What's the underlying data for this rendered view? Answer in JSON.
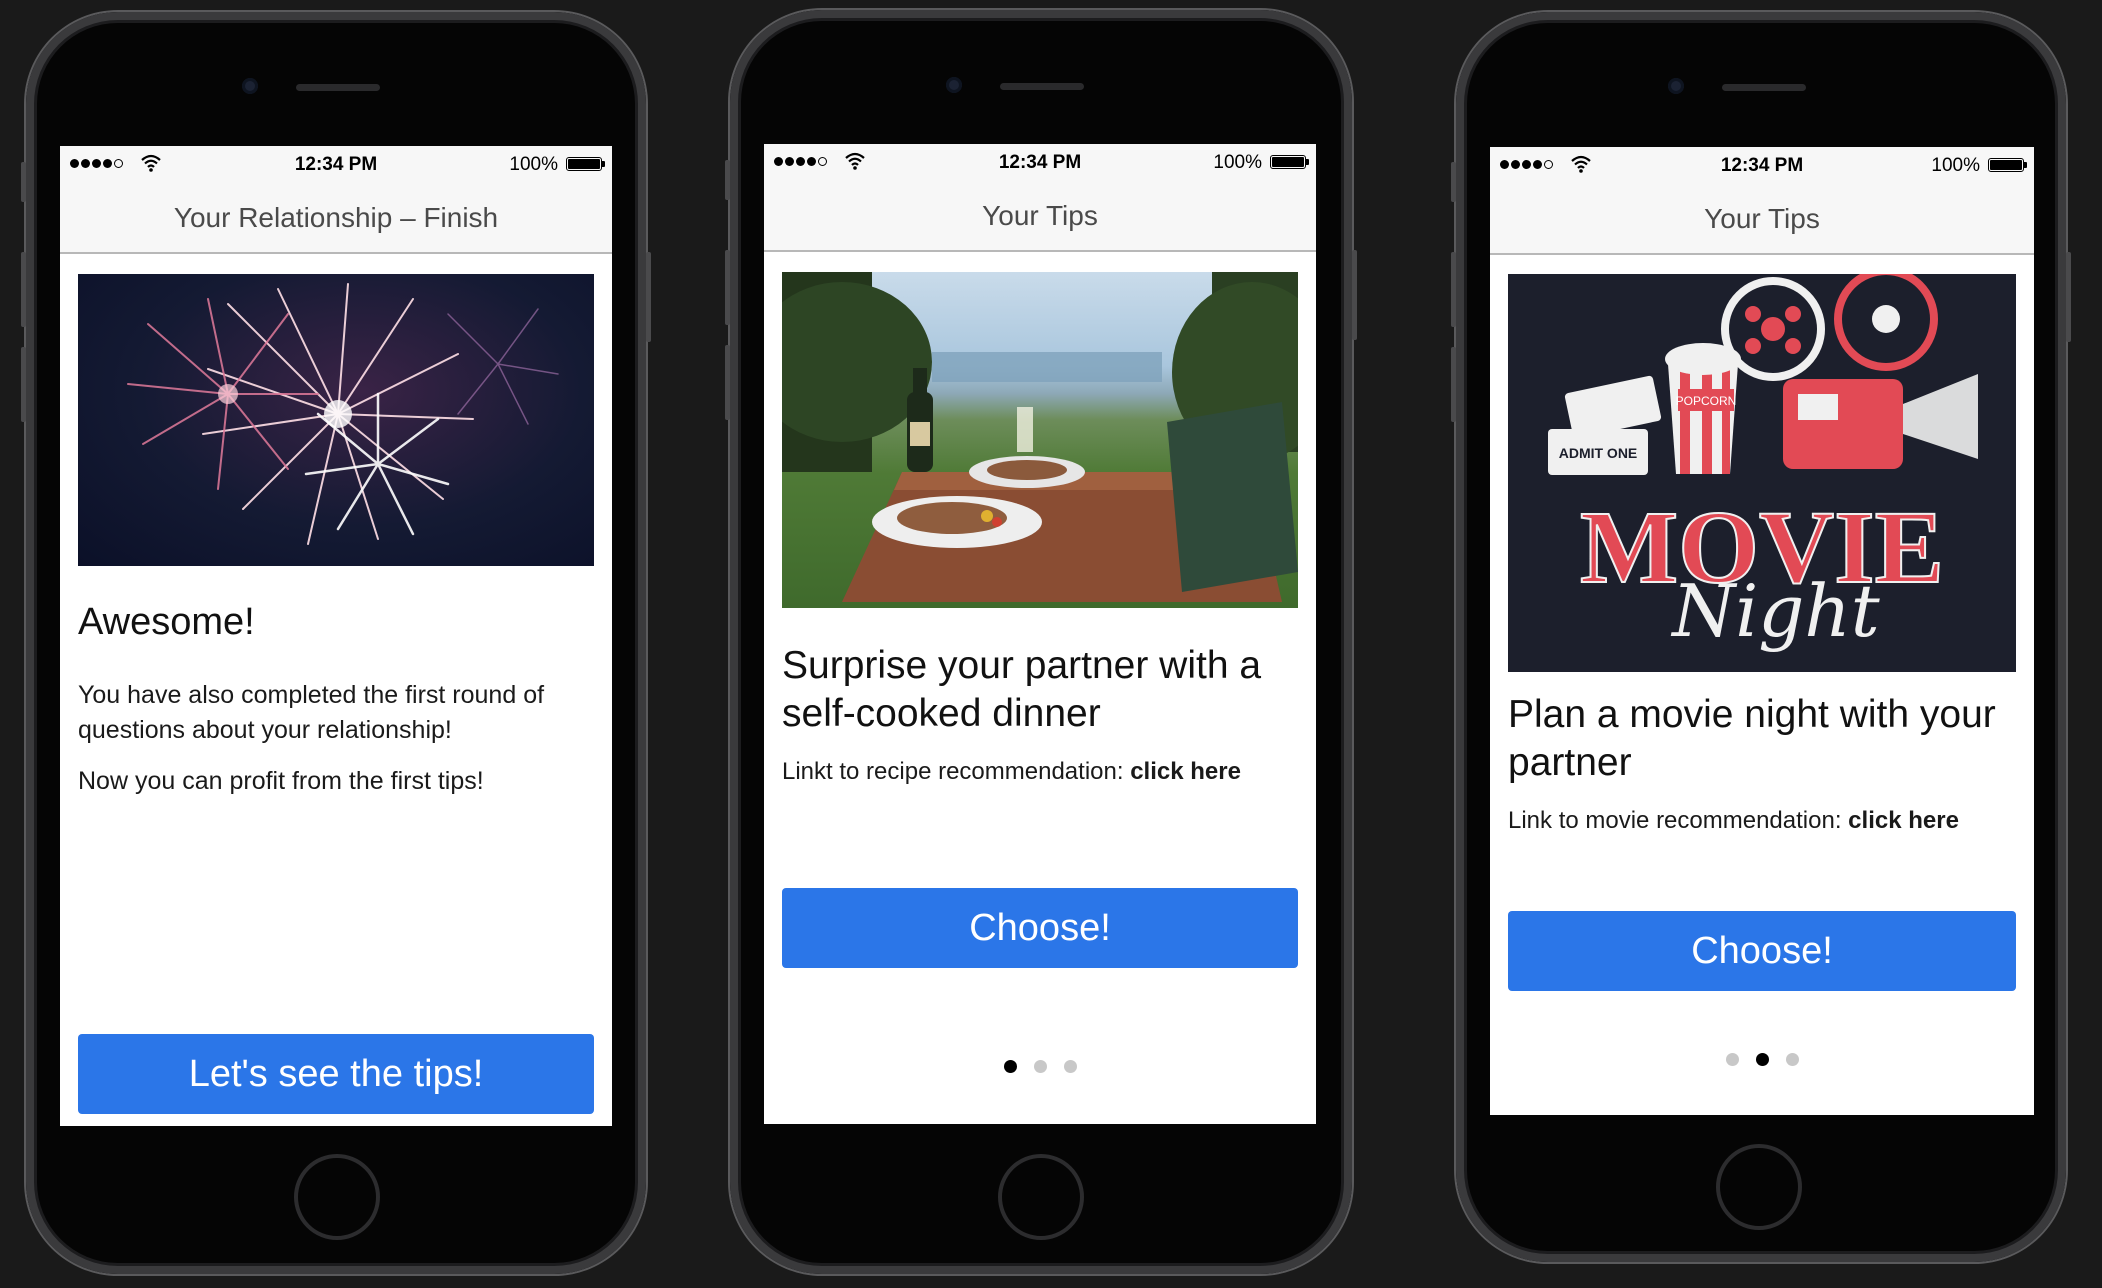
{
  "phones": [
    {
      "status": {
        "time": "12:34 PM",
        "battery": "100%"
      },
      "nav_title": "Your Relationship – Finish",
      "image": "fireworks-image",
      "heading": "Awesome!",
      "paragraph1": "You have also completed the first round of questions about your relationship!",
      "paragraph2": "Now you can profit from the first tips!",
      "button": "Let's see the tips!"
    },
    {
      "status": {
        "time": "12:34 PM",
        "battery": "100%"
      },
      "nav_title": "Your Tips",
      "image": "dinner-image",
      "heading": "Surprise your partner with a self-cooked dinner",
      "link_prefix": "Linkt to recipe recommendation: ",
      "link_text": "click here",
      "button": "Choose!",
      "page_index": 0,
      "page_count": 3
    },
    {
      "status": {
        "time": "12:34 PM",
        "battery": "100%"
      },
      "nav_title": "Your Tips",
      "image": "movie-night-image",
      "image_text": {
        "tickets": "ADMIT ONE",
        "popcorn": "POPCORN",
        "movie": "MOVIE",
        "night": "Night"
      },
      "heading": "Plan a movie night with your partner",
      "link_prefix": "Link to movie recommendation: ",
      "link_text": "click here",
      "button": "Choose!",
      "page_index": 1,
      "page_count": 3
    }
  ],
  "colors": {
    "accent": "#2b76e8",
    "background": "#1a1a1a",
    "navbar": "#f7f7f7"
  }
}
